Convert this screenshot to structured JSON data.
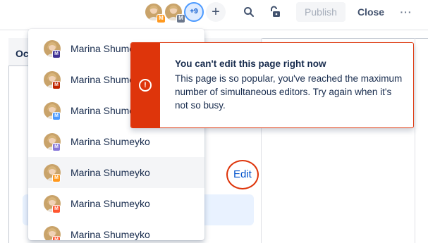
{
  "toolbar": {
    "extra_collaborators": "+9",
    "add_glyph": "+",
    "publish_label": "Publish",
    "close_label": "Close",
    "more_glyph": "···",
    "avatars": [
      {
        "badge": "M",
        "badge_color": "#ff991f"
      },
      {
        "badge": "M",
        "badge_color": "#6b778c"
      }
    ]
  },
  "table": {
    "header_text": "Oc"
  },
  "edit_link": "Edit",
  "dropdown": {
    "items": [
      {
        "name": "Marina Shumeyko",
        "badge": "M",
        "badge_color": "#403294"
      },
      {
        "name": "Marina Shumeyko",
        "badge": "M",
        "badge_color": "#bf2600"
      },
      {
        "name": "Marina Shumeyko",
        "badge": "M",
        "badge_color": "#4c9aff"
      },
      {
        "name": "Marina Shumeyko",
        "badge": "M",
        "badge_color": "#8777d9"
      },
      {
        "name": "Marina Shumeyko",
        "badge": "M",
        "badge_color": "#ff991f"
      },
      {
        "name": "Marina Shumeyko",
        "badge": "M",
        "badge_color": "#ff5630"
      },
      {
        "name": "Marina Shumeyko",
        "badge": "M",
        "badge_color": "#ff5630"
      }
    ]
  },
  "error_flag": {
    "icon": "!",
    "title": "You can't edit this page right now",
    "body": "This page is so popular, you've reached the maximum number of simultaneous editors. Try again when it's not so busy.",
    "accent": "#de350b"
  }
}
